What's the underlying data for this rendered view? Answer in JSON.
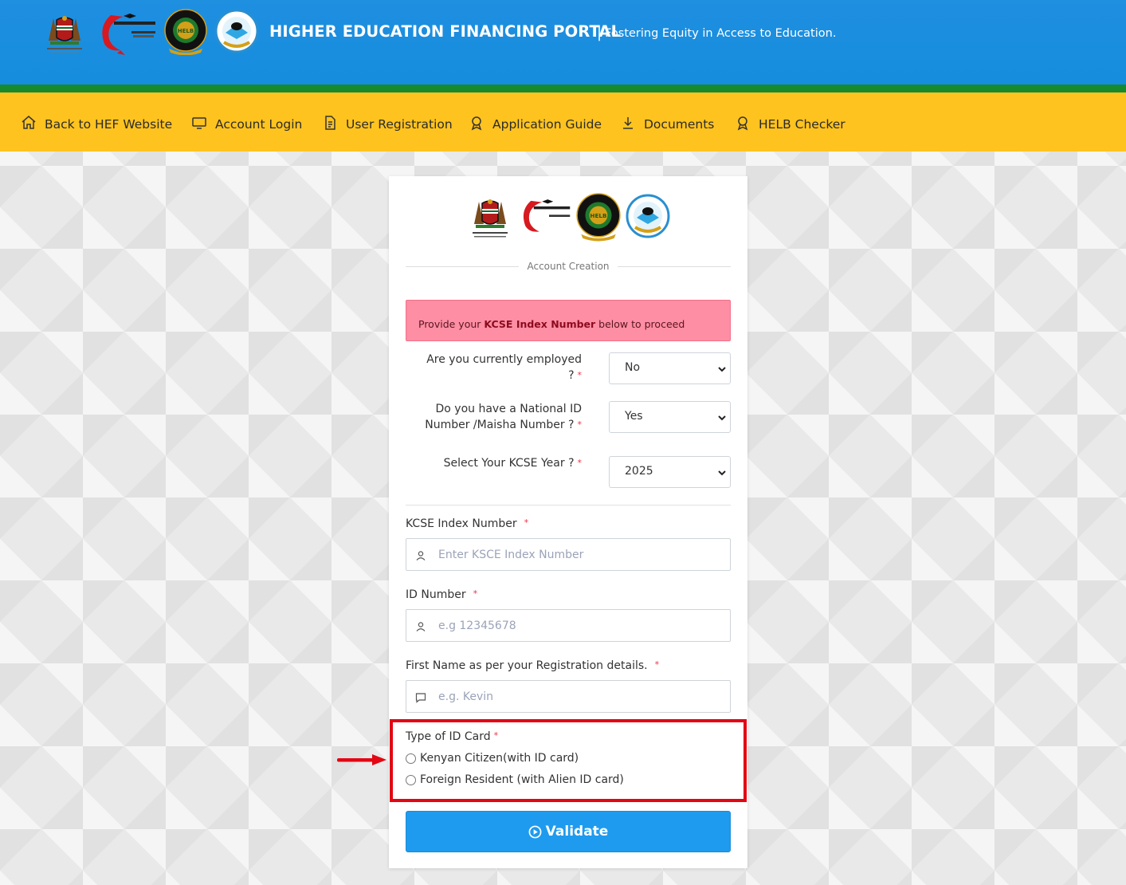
{
  "header": {
    "title": "HIGHER EDUCATION FINANCING PORTAL",
    "tagline": "Fostering Equity in Access to Education."
  },
  "nav": {
    "items": [
      {
        "label": "Back to HEF Website",
        "icon": "home-icon"
      },
      {
        "label": "Account Login",
        "icon": "monitor-icon"
      },
      {
        "label": "User Registration",
        "icon": "document-icon"
      },
      {
        "label": "Application Guide",
        "icon": "award-icon"
      },
      {
        "label": "Documents",
        "icon": "download-icon"
      },
      {
        "label": "HELB Checker",
        "icon": "award-icon"
      }
    ]
  },
  "form": {
    "section_title": "Account Creation",
    "alert": {
      "prefix": "Provide your ",
      "bold": "KCSE Index Number",
      "suffix": " below to proceed"
    },
    "employed": {
      "label": "Are you currently employed ?",
      "value": "No"
    },
    "national_id": {
      "label": "Do you have a National ID Number /Maisha Number ?",
      "value": "Yes"
    },
    "kcse_year": {
      "label": "Select Your KCSE Year ?",
      "value": "2025"
    },
    "required_mark": "*",
    "kcse_index": {
      "label": "KCSE Index Number",
      "placeholder": "Enter KSCE Index Number"
    },
    "id_number": {
      "label": "ID Number",
      "placeholder": "e.g 12345678"
    },
    "first_name": {
      "label": "First Name as per your Registration details.",
      "placeholder": "e.g. Kevin"
    },
    "id_type": {
      "label": "Type of ID Card",
      "options": [
        "Kenyan Citizen(with ID card)",
        "Foreign Resident (with Alien ID card)"
      ]
    },
    "submit": "Validate"
  },
  "colors": {
    "header_blue": "#168ddd",
    "nav_yellow": "#fec31f",
    "stripe_green": "#178a2d",
    "button_blue": "#1e9bef",
    "alert_pink": "#fe8ea3",
    "highlight_red": "#e30613"
  }
}
